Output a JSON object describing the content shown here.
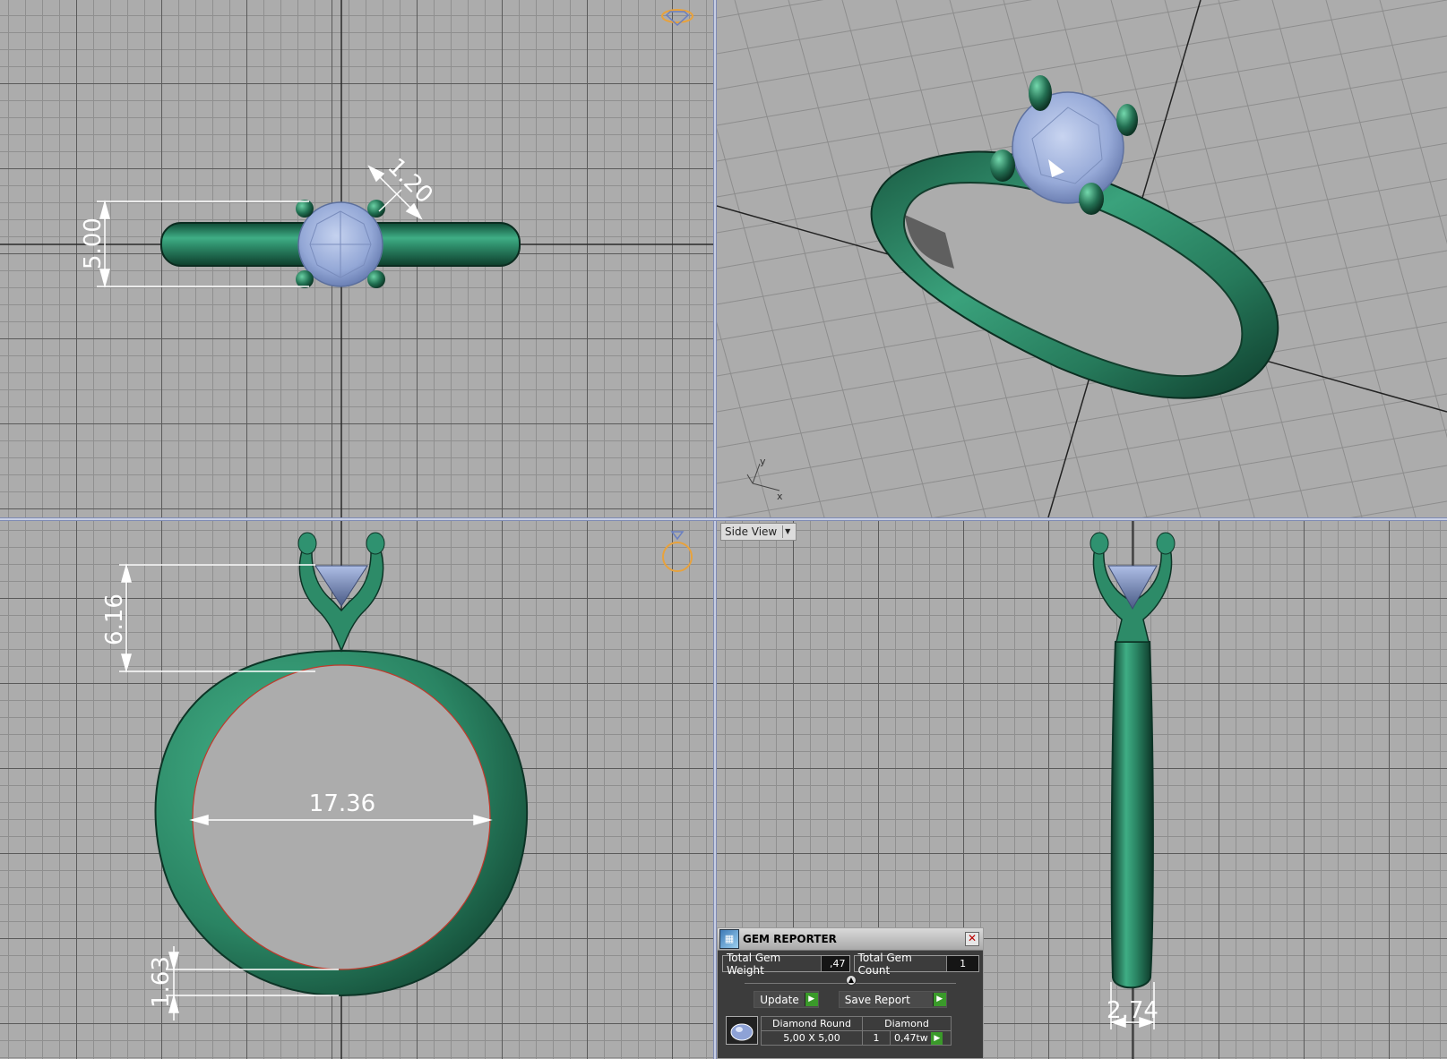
{
  "viewports": {
    "top_left": {
      "dimensions": {
        "width_label": "5.00",
        "prong_label": "1.20"
      }
    },
    "top_right": {
      "axis": {
        "x_label": "x",
        "y_label": "y"
      }
    },
    "bottom_left": {
      "dimensions": {
        "height_label": "6.16",
        "diameter_label": "17.36",
        "thickness_label": "1.63"
      }
    },
    "bottom_right": {
      "view_label": "Side View",
      "dimensions": {
        "width_label": "2.74"
      }
    }
  },
  "gem_reporter": {
    "title": "GEM REPORTER",
    "total_gem_weight_label": "Total Gem Weight",
    "total_gem_weight_value": ",47",
    "total_gem_count_label": "Total Gem Count",
    "total_gem_count_value": "1",
    "update_label": "Update",
    "save_report_label": "Save Report",
    "gem": {
      "shape": "Diamond Round",
      "material": "Diamond",
      "size": "5,00 X 5,00",
      "count": "1",
      "weight": "0,47tw"
    }
  },
  "colors": {
    "metal": "#2e8a68",
    "gem": "#9fb2dc",
    "grid_major": "#5a5a5a",
    "grid_minor": "#8f8f8f",
    "dimension": "#ffffff",
    "gizmo": "#e8a23c"
  }
}
